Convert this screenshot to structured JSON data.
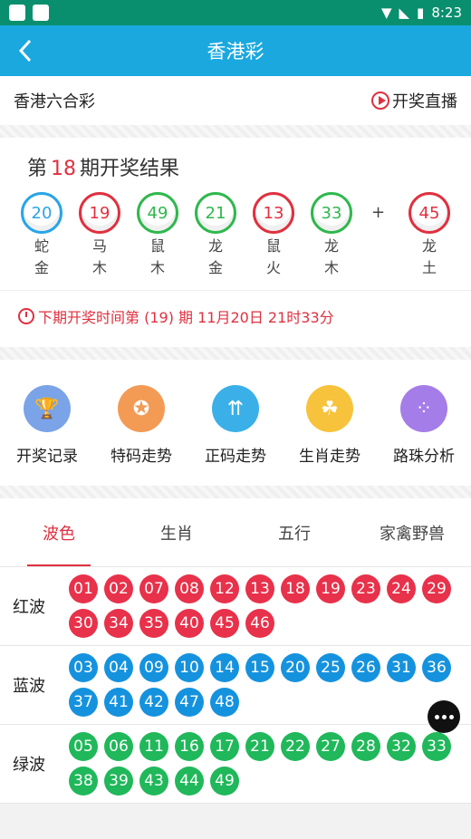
{
  "status": {
    "time": "8:23"
  },
  "header": {
    "title": "香港彩"
  },
  "subbar": {
    "name": "香港六合彩",
    "live_label": "开奖直播"
  },
  "result": {
    "prefix": "第",
    "issue": "18",
    "suffix": "期开奖结果",
    "balls": [
      {
        "num": "20",
        "color": "blue",
        "zodiac": "蛇",
        "element": "金"
      },
      {
        "num": "19",
        "color": "red",
        "zodiac": "马",
        "element": "木"
      },
      {
        "num": "49",
        "color": "green",
        "zodiac": "鼠",
        "element": "木"
      },
      {
        "num": "21",
        "color": "green",
        "zodiac": "龙",
        "element": "金"
      },
      {
        "num": "13",
        "color": "red",
        "zodiac": "鼠",
        "element": "火"
      },
      {
        "num": "33",
        "color": "green",
        "zodiac": "龙",
        "element": "木"
      }
    ],
    "plus": "+",
    "special": {
      "num": "45",
      "color": "red",
      "zodiac": "龙",
      "element": "土"
    },
    "next_text": "下期开奖时间第 (19) 期  11月20日 21时33分"
  },
  "menu": [
    {
      "label": "开奖记录",
      "icon": "trophy-icon",
      "color": "#7aa3e8",
      "glyph": "🏆"
    },
    {
      "label": "特码走势",
      "icon": "medal-icon",
      "color": "#f39a55",
      "glyph": "✪"
    },
    {
      "label": "正码走势",
      "icon": "trend-icon",
      "color": "#3bb0e8",
      "glyph": "⇈"
    },
    {
      "label": "生肖走势",
      "icon": "rabbit-icon",
      "color": "#f7c33c",
      "glyph": "☘"
    },
    {
      "label": "路珠分析",
      "icon": "beads-icon",
      "color": "#a57de8",
      "glyph": "⁘"
    }
  ],
  "tabs": [
    "波色",
    "生肖",
    "五行",
    "家禽野兽"
  ],
  "waves": [
    {
      "label": "红波",
      "color": "red",
      "nums": [
        "01",
        "02",
        "07",
        "08",
        "12",
        "13",
        "18",
        "19",
        "23",
        "24",
        "29",
        "30",
        "34",
        "35",
        "40",
        "45",
        "46"
      ]
    },
    {
      "label": "蓝波",
      "color": "blue",
      "nums": [
        "03",
        "04",
        "09",
        "10",
        "14",
        "15",
        "20",
        "25",
        "26",
        "31",
        "36",
        "37",
        "41",
        "42",
        "47",
        "48"
      ]
    },
    {
      "label": "绿波",
      "color": "green",
      "nums": [
        "05",
        "06",
        "11",
        "16",
        "17",
        "21",
        "22",
        "27",
        "28",
        "32",
        "33",
        "38",
        "39",
        "43",
        "44",
        "49"
      ]
    }
  ]
}
